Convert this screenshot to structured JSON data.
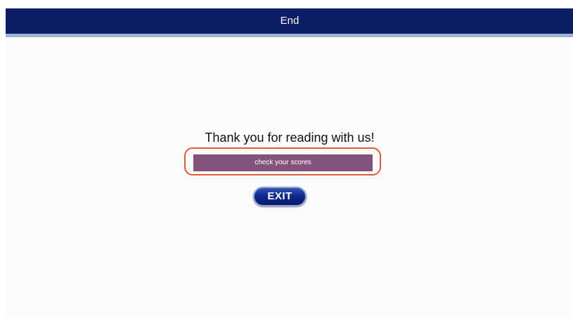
{
  "window": {
    "title": "End"
  },
  "main": {
    "heading": "Thank you for reading with us!",
    "scores_button_label": "check your scores",
    "exit_button_label": "EXIT"
  },
  "colors": {
    "title_bar": "#0b1d63",
    "scores_button": "#85527d",
    "highlight_outline": "#e25a38",
    "exit_button": "#0e2a8f"
  }
}
